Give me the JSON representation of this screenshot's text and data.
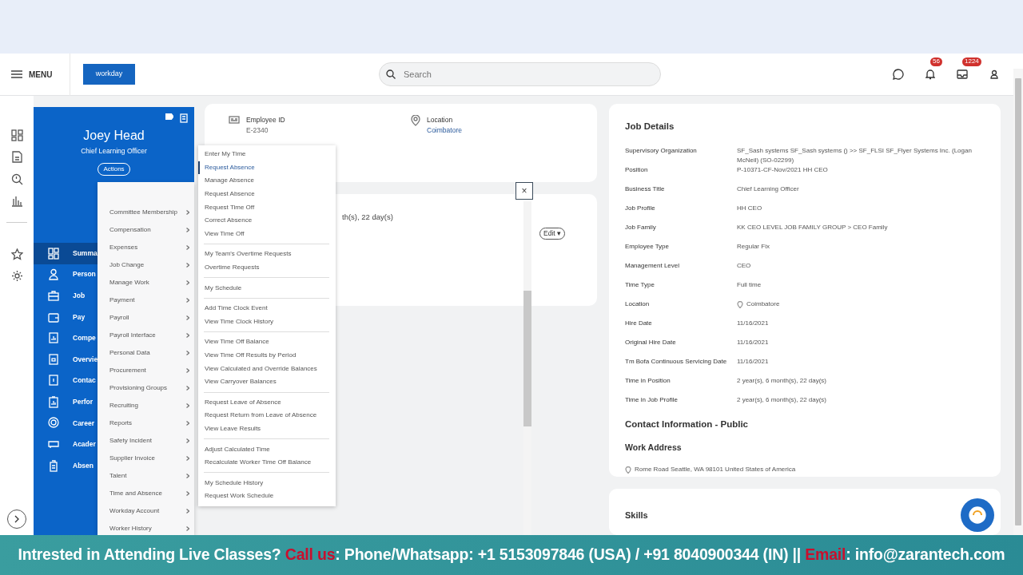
{
  "header": {
    "menu_label": "MENU",
    "logo": "workday",
    "search_placeholder": "Search",
    "notification_count": "56",
    "inbox_count": "1224"
  },
  "profile": {
    "name": "Joey Head",
    "title": "Chief Learning Officer",
    "actions_label": "Actions",
    "nav": [
      {
        "label": "Summa",
        "selected": true
      },
      {
        "label": "Person",
        "selected": false
      },
      {
        "label": "Job",
        "selected": false
      },
      {
        "label": "Pay",
        "selected": false
      },
      {
        "label": "Compe",
        "selected": false
      },
      {
        "label": "Overvie",
        "selected": false
      },
      {
        "label": "Contac",
        "selected": false
      },
      {
        "label": "Perfor",
        "selected": false
      },
      {
        "label": "Career",
        "selected": false
      },
      {
        "label": "Acader",
        "selected": false
      },
      {
        "label": "Absen",
        "selected": false
      }
    ]
  },
  "summary_card": {
    "fields": [
      {
        "label": "Employee ID",
        "value": "E-2340",
        "kind": "text"
      },
      {
        "label": "Location",
        "value": "Coimbatore",
        "kind": "link"
      }
    ]
  },
  "time_card": {
    "fragment": "th(s), 22 day(s)",
    "edit_label": "Edit",
    "edit_caret": "▾"
  },
  "close_label": "×",
  "actions_menu": [
    "Committee Membership",
    "Compensation",
    "Expenses",
    "Job Change",
    "Manage Work",
    "Payment",
    "Payroll",
    "Payroll Interface",
    "Personal Data",
    "Procurement",
    "Provisioning Groups",
    "Recruiting",
    "Reports",
    "Safety Incident",
    "Supplier Invoice",
    "Talent",
    "Time and Absence",
    "Workday Account",
    "Worker History"
  ],
  "submenu": [
    [
      {
        "label": "Enter My Time",
        "selected": false
      },
      {
        "label": "Request Absence",
        "selected": true
      },
      {
        "label": "Manage Absence",
        "selected": false
      },
      {
        "label": "Request Absence",
        "selected": false
      },
      {
        "label": "Request Time Off",
        "selected": false
      },
      {
        "label": "Correct Absence",
        "selected": false
      },
      {
        "label": "View Time Off",
        "selected": false
      }
    ],
    [
      {
        "label": "My Team's Overtime Requests",
        "selected": false
      },
      {
        "label": "Overtime Requests",
        "selected": false
      }
    ],
    [
      {
        "label": "My Schedule",
        "selected": false
      }
    ],
    [
      {
        "label": "Add Time Clock Event",
        "selected": false
      },
      {
        "label": "View Time Clock History",
        "selected": false
      }
    ],
    [
      {
        "label": "View Time Off Balance",
        "selected": false
      },
      {
        "label": "View Time Off Results by Period",
        "selected": false
      },
      {
        "label": "View Calculated and Override Balances",
        "selected": false
      },
      {
        "label": "View Carryover Balances",
        "selected": false
      }
    ],
    [
      {
        "label": "Request Leave of Absence",
        "selected": false
      },
      {
        "label": "Request Return from Leave of Absence",
        "selected": false
      },
      {
        "label": "View Leave Results",
        "selected": false
      }
    ],
    [
      {
        "label": "Adjust Calculated Time",
        "selected": false
      },
      {
        "label": "Recalculate Worker Time Off Balance",
        "selected": false
      }
    ],
    [
      {
        "label": "My Schedule History",
        "selected": false
      },
      {
        "label": "Request Work Schedule",
        "selected": false
      }
    ]
  ],
  "job_details": {
    "title": "Job Details",
    "rows": [
      {
        "label": "Supervisory Organization",
        "value": "SF_Sash systems SF_Sash systems () >> SF_FLSI SF_Flyer Systems Inc. (Logan McNeil) (SO-02299)",
        "kind": "link"
      },
      {
        "label": "Position",
        "value": "P-10371-CF-Nov/2021 HH CEO",
        "kind": "link"
      },
      {
        "label": "Business Title",
        "value": "Chief Learning Officer",
        "kind": "text"
      },
      {
        "label": "Job Profile",
        "value": "HH CEO",
        "kind": "link"
      },
      {
        "label": "Job Family",
        "value": "KK CEO LEVEL JOB FAMILY GROUP > CEO Family",
        "kind": "text"
      },
      {
        "label": "Employee Type",
        "value": "Regular Fix",
        "kind": "link"
      },
      {
        "label": "Management Level",
        "value": "CEO",
        "kind": "link"
      },
      {
        "label": "Time Type",
        "value": "Full time",
        "kind": "text"
      },
      {
        "label": "Location",
        "value": "Coimbatore",
        "kind": "location"
      },
      {
        "label": "Hire Date",
        "value": "11/16/2021",
        "kind": "text"
      },
      {
        "label": "Original Hire Date",
        "value": "11/16/2021",
        "kind": "text"
      },
      {
        "label": "Tm Bofa Continuous Servicing Date",
        "value": "11/16/2021",
        "kind": "text"
      },
      {
        "label": "Time in Position",
        "value": "2 year(s), 6 month(s), 22 day(s)",
        "kind": "text"
      },
      {
        "label": "Time in Job Profile",
        "value": "2 year(s), 6 month(s), 22 day(s)",
        "kind": "text"
      }
    ]
  },
  "contact": {
    "title": "Contact Information - Public",
    "subtitle": "Work Address",
    "address": "Rome Road Seattle, WA 98101 United States of America"
  },
  "skills": {
    "title": "Skills"
  },
  "banner": [
    {
      "text": "Intrested in Attending Live Classes? ",
      "kind": "plain"
    },
    {
      "text": "Call us",
      "kind": "accent"
    },
    {
      "text": ": Phone/Whatsapp: +1 5153097846 (USA) / +91 8040900344 (IN) || ",
      "kind": "plain"
    },
    {
      "text": "Email",
      "kind": "accent"
    },
    {
      "text": ": info@zarantech.com",
      "kind": "plain"
    }
  ]
}
